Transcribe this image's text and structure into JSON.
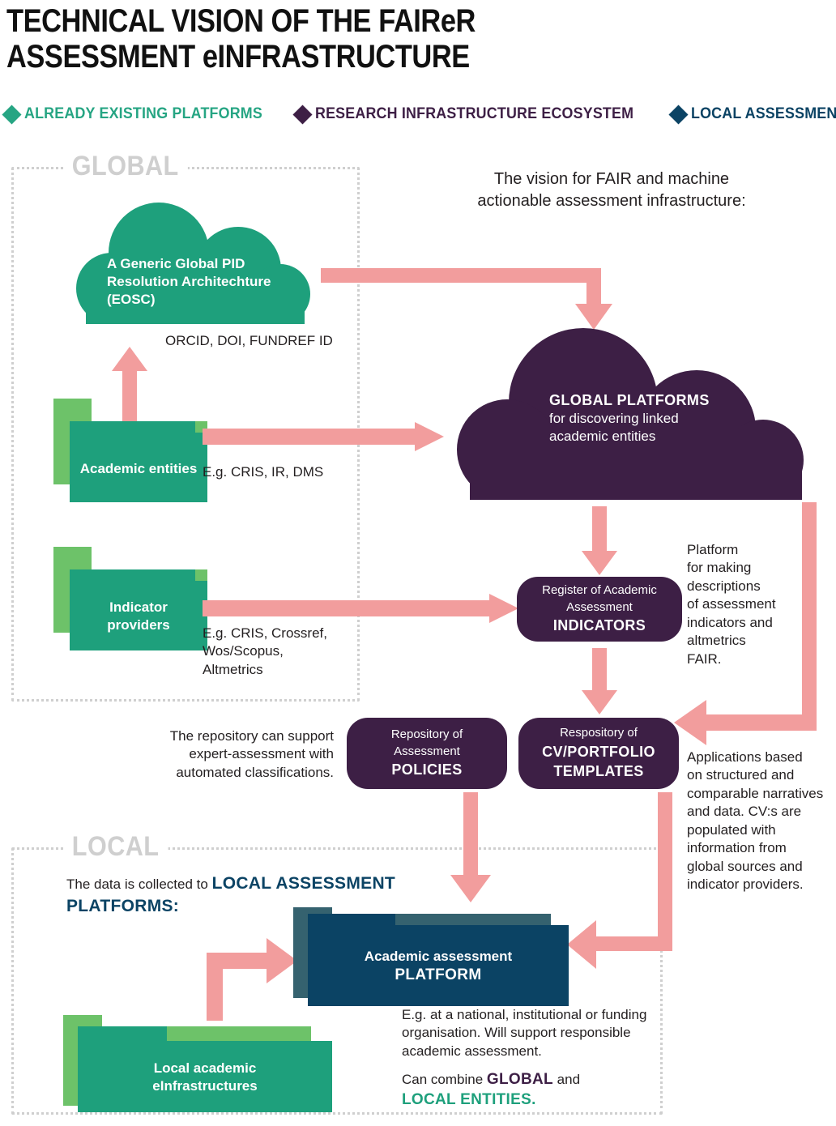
{
  "title": {
    "line1": "TECHNICAL VISION OF THE FAIReR",
    "line2": "ASSESSMENT eINFRASTRUCTURE"
  },
  "legend": {
    "items": [
      {
        "label": "ALREADY EXISTING PLATFORMS",
        "color": "#26A583",
        "icon": "diamond-icon"
      },
      {
        "label": "RESEARCH INFRASTRUCTURE ECOSYSTEM",
        "color": "#3D1F45",
        "icon": "diamond-icon"
      },
      {
        "label": "LOCAL ASSESSMENT PLATTFORMS",
        "color": "#0B4364",
        "icon": "diamond-icon"
      }
    ]
  },
  "zones": {
    "global_label": "GLOBAL",
    "local_label": "LOCAL"
  },
  "intro": {
    "line1": "The vision for FAIR and machine",
    "line2": "actionable assessment infrastructure:"
  },
  "global": {
    "pid_cloud": {
      "line1": "A Generic Global PID",
      "line2": "Resolution Architechture",
      "line3": "(EOSC)"
    },
    "pid_caption": "ORCID, DOI, FUNDREF ID",
    "academic_entities": {
      "label": "Academic entities",
      "caption": "E.g. CRIS, IR, DMS"
    },
    "indicator_providers": {
      "label_line1": "Indicator",
      "label_line2": "providers",
      "caption_line1": "E.g. CRIS, Crossref,",
      "caption_line2": "Wos/Scopus,",
      "caption_line3": "Altmetrics"
    },
    "global_platforms_cloud": {
      "title": "GLOBAL PLATFORMS",
      "line2": "for discovering linked",
      "line3": "academic entities"
    }
  },
  "registers": {
    "indicators": {
      "line1": "Register of Academic",
      "line2": "Assessment",
      "strong": "INDICATORS"
    },
    "policies": {
      "line1": "Repository of",
      "line2": "Assessment",
      "strong": "POLICIES"
    },
    "cv_templates": {
      "line1": "Respository of",
      "strong1": "CV/PORTFOLIO",
      "strong2": "TEMPLATES"
    }
  },
  "annotations": {
    "platform_for_making": "Platform\nfor making\ndescriptions\nof assessment\nindicators and\naltmetrics\nFAIR.",
    "repository_support": "The repository can support\nexpert-assessment with\nautomated classifications.",
    "applications_based": "Applications based\non structured and\ncomparable narratives\nand data. CV:s are\npopulated with\ninformation from\nglobal sources and\nindicator providers."
  },
  "local": {
    "collected_prefix": "The data is collected to",
    "collected_strong": "LOCAL ASSESSMENT PLATFORMS:",
    "platform_card": {
      "line1": "Academic assessment",
      "line2": "PLATFORM"
    },
    "platform_caption_line1": "E.g. at a national, institutional or funding",
    "platform_caption_line2": "organisation. Will support responsible",
    "platform_caption_line3": "academic assessment.",
    "combine_prefix": "Can combine",
    "combine_global": "GLOBAL",
    "combine_and": "and",
    "combine_local": "LOCAL ENTITIES.",
    "einfra_card": {
      "line1": "Local academic",
      "line2": "eInfrastructures"
    }
  },
  "colors": {
    "green": "#1EA07C",
    "green_light": "#6DC269",
    "purple": "#3D1F45",
    "blue": "#0B4364",
    "blue_light": "#35626F",
    "pink": "#F29D9D",
    "grey_dash": "#cfcfcf"
  }
}
